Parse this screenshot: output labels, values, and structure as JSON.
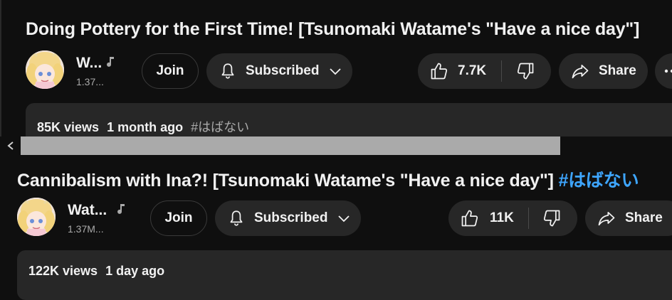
{
  "video1": {
    "title": "Doing Pottery for the First Time! [Tsunomaki Watame's \"Have a nice day\"]",
    "channel_name": "W...",
    "subscribers": "1.37...",
    "join_label": "Join",
    "subscribed_label": "Subscribed",
    "likes": "7.7K",
    "share_label": "Share",
    "views": "85K views",
    "age": "1 month ago",
    "hashtag": "#はばない"
  },
  "video2": {
    "title": "Cannibalism with Ina?! [Tsunomaki Watame's \"Have a nice day\"]",
    "title_hashtag": "#はばない",
    "channel_name": "Wat...",
    "subscribers": "1.37M...",
    "join_label": "Join",
    "subscribed_label": "Subscribed",
    "likes": "11K",
    "share_label": "Share",
    "views": "122K views",
    "age": "1 day ago"
  },
  "icons": {
    "music_note": "music-note-icon",
    "bell": "bell-icon",
    "chevron": "chevron-down-icon",
    "like": "thumbs-up-icon",
    "dislike": "thumbs-down-icon",
    "share": "share-arrow-icon",
    "more": "more-horizontal-icon",
    "scroll_left": "chevron-left-icon"
  },
  "colors": {
    "background": "#0f0f0f",
    "pill": "#272727",
    "hashtag": "#3ea6ff",
    "secondary_text": "#aaaaaa"
  }
}
